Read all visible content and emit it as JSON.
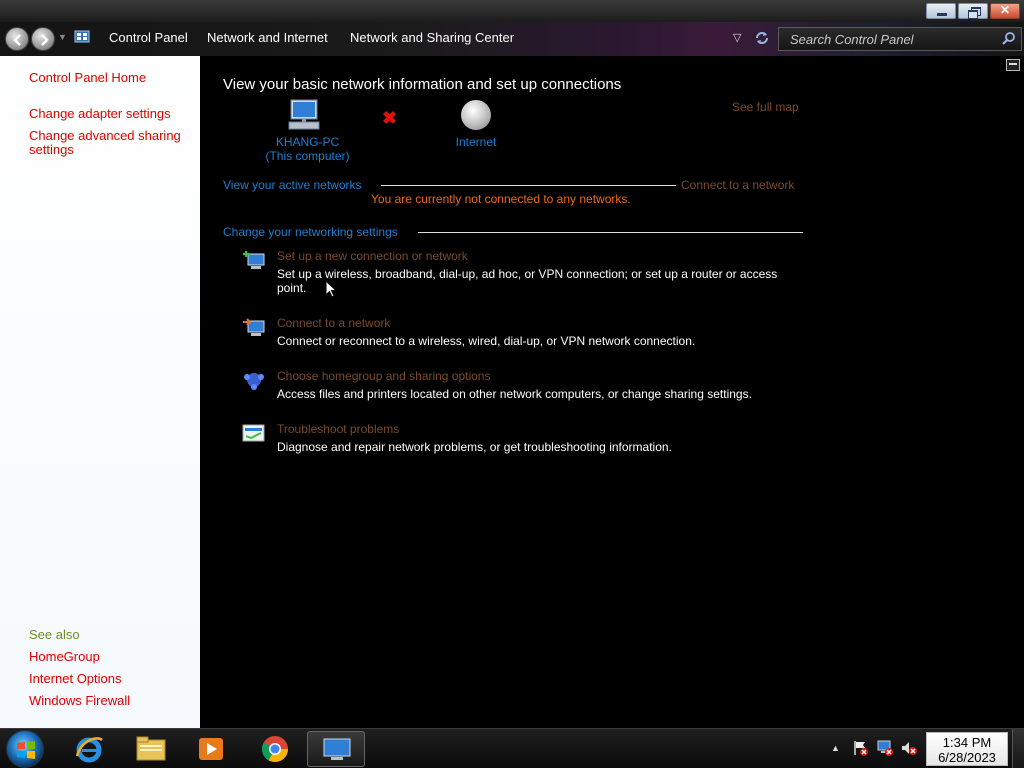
{
  "window": {
    "close_glyph": "✕"
  },
  "addressbar": {
    "breadcrumbs": [
      "Control Panel",
      "Network and Internet",
      "Network and Sharing Center"
    ],
    "search_placeholder": "Search Control Panel"
  },
  "leftpane": {
    "control_panel_home": "Control Panel Home",
    "change_adapter_settings": "Change adapter settings",
    "change_advanced_sharing": "Change advanced sharing settings",
    "see_also": "See also",
    "homegroup": "HomeGroup",
    "internet_options": "Internet Options",
    "windows_firewall": "Windows Firewall"
  },
  "main": {
    "title": "View your basic network information and set up connections",
    "see_full_map": "See full map",
    "computer_name": "KHANG-PC",
    "computer_sub": "(This computer)",
    "internet_label": "Internet",
    "active_networks": "View your active networks",
    "connect_to_network_link": "Connect to a network",
    "not_connected": "You are currently not connected to any networks.",
    "change_settings": "Change your networking settings",
    "tasks": [
      {
        "title": "Set up a new connection or network",
        "desc": "Set up a wireless, broadband, dial-up, ad hoc, or VPN connection; or set up a router or access point."
      },
      {
        "title": "Connect to a network",
        "desc": "Connect or reconnect to a wireless, wired, dial-up, or VPN network connection."
      },
      {
        "title": "Choose homegroup and sharing options",
        "desc": "Access files and printers located on other network computers, or change sharing settings."
      },
      {
        "title": "Troubleshoot problems",
        "desc": "Diagnose and repair network problems, or get troubleshooting information."
      }
    ]
  },
  "taskbar": {
    "time": "1:34 PM",
    "date": "6/28/2023"
  }
}
